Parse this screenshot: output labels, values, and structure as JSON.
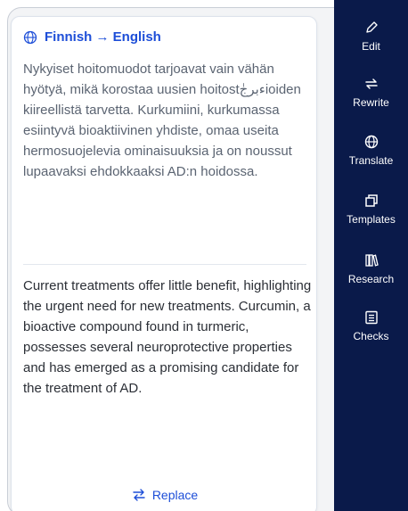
{
  "panel": {
    "header": {
      "icon": "globe-icon",
      "title": "Finnish → English"
    },
    "source_text": "Nykyiset hoitomuodot tarjoavat vain vähän hyötyä, mikä korostaa uusien hoitostءبرجٰioiden kiireellistä tarvetta. Kurkumiini, kurkumassa esiintyvä bioaktiivinen yhdiste, omaa useita hermosuojelevia ominaisuuksia ja on noussut lupaavaksi ehdokkaaksi AD:n hoidossa.",
    "translated_text": "Current treatments offer little benefit, highlighting the urgent need for new treatments. Curcumin, a bioactive compound found in turmeric, possesses several neuroprotective properties and has emerged as a promising candidate for the treatment of AD.",
    "replace": {
      "icon": "swap-icon",
      "label": "Replace"
    }
  },
  "sidebar": {
    "items": [
      {
        "label": "Edit",
        "icon": "pen-icon"
      },
      {
        "label": "Rewrite",
        "icon": "rewrite-icon"
      },
      {
        "label": "Translate",
        "icon": "globe-icon"
      },
      {
        "label": "Templates",
        "icon": "templates-icon"
      },
      {
        "label": "Research",
        "icon": "books-icon"
      },
      {
        "label": "Checks",
        "icon": "checklist-icon"
      }
    ]
  },
  "colors": {
    "accent": "#1d4ed8",
    "sidebar_bg": "#0a1a4a"
  }
}
